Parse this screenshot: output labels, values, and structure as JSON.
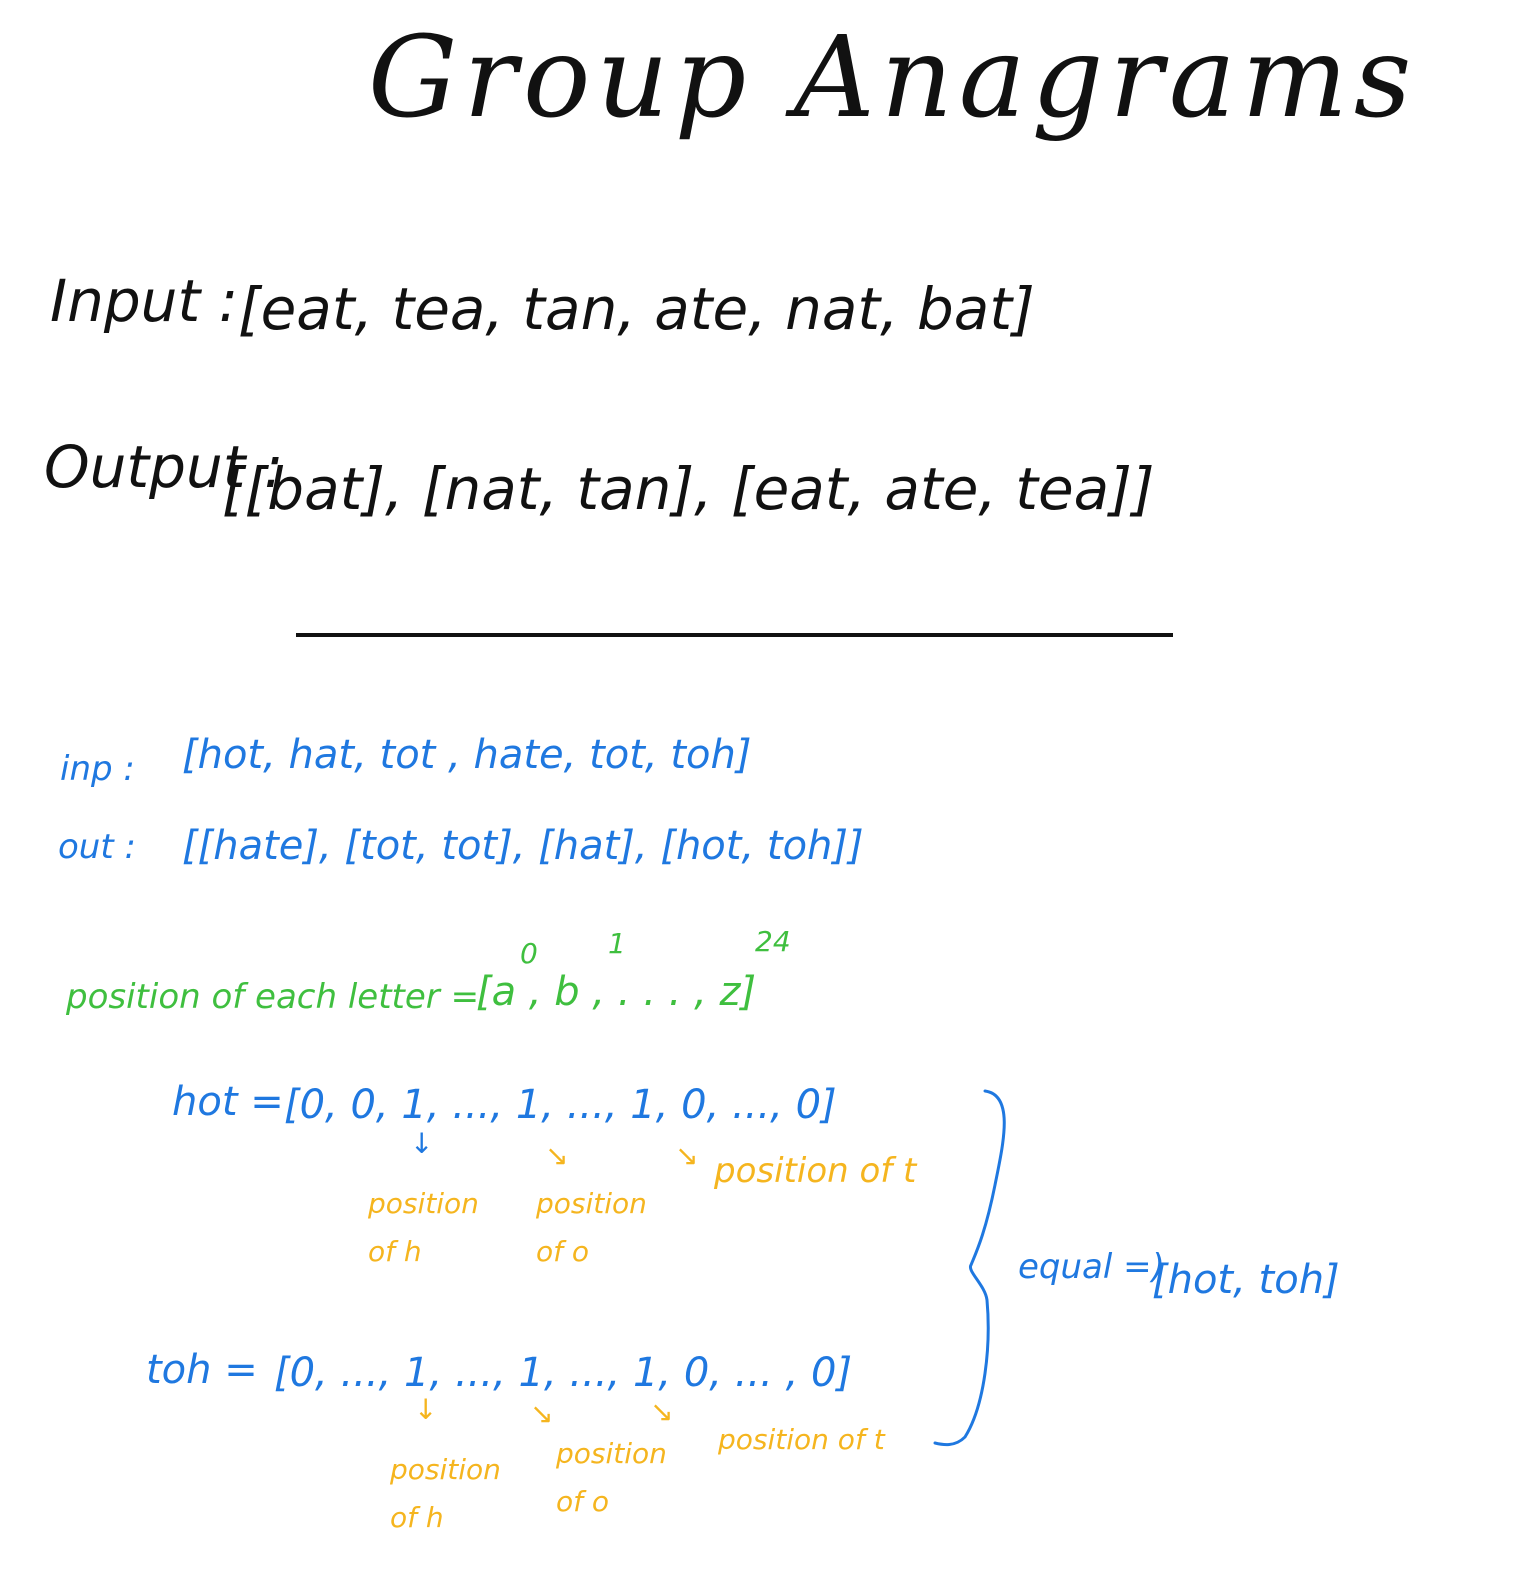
{
  "title": "Group Anagrams",
  "example": {
    "input_label": "Input :",
    "input_value": "[eat, tea, tan, ate, nat, bat]",
    "output_label": "Output :",
    "output_value": "[[bat], [nat, tan], [eat, ate, tea]]"
  },
  "custom": {
    "inp_label": "inp :",
    "inp_value": "[hot, hat, tot , hate, tot, toh]",
    "out_label": "out :",
    "out_value": "[[hate], [tot, tot], [hat], [hot, toh]]"
  },
  "positions": {
    "label": "position of each letter =",
    "vector": "[a , b , . . . , z]",
    "index_0": "0",
    "index_1": "1",
    "index_last": "24"
  },
  "hot_vector": {
    "label": "hot =",
    "value": "[0, 0, 1, ..., 1, ..., 1, 0, ..., 0]",
    "note_h": "position of h",
    "note_o": "position of o",
    "note_t": "position of t"
  },
  "toh_vector": {
    "label": "toh =",
    "value": "[0, ..., 1, ..., 1, ..., 1, 0, ... , 0]",
    "note_h": "position of h",
    "note_o": "position of o",
    "note_t": "position of t"
  },
  "conclusion": {
    "equal_text": "equal =)",
    "result": "[hot, toh]"
  },
  "colors": {
    "ink": "#111111",
    "blue": "#1f78e0",
    "green": "#3fbf3f",
    "yellow": "#f5b51f"
  }
}
